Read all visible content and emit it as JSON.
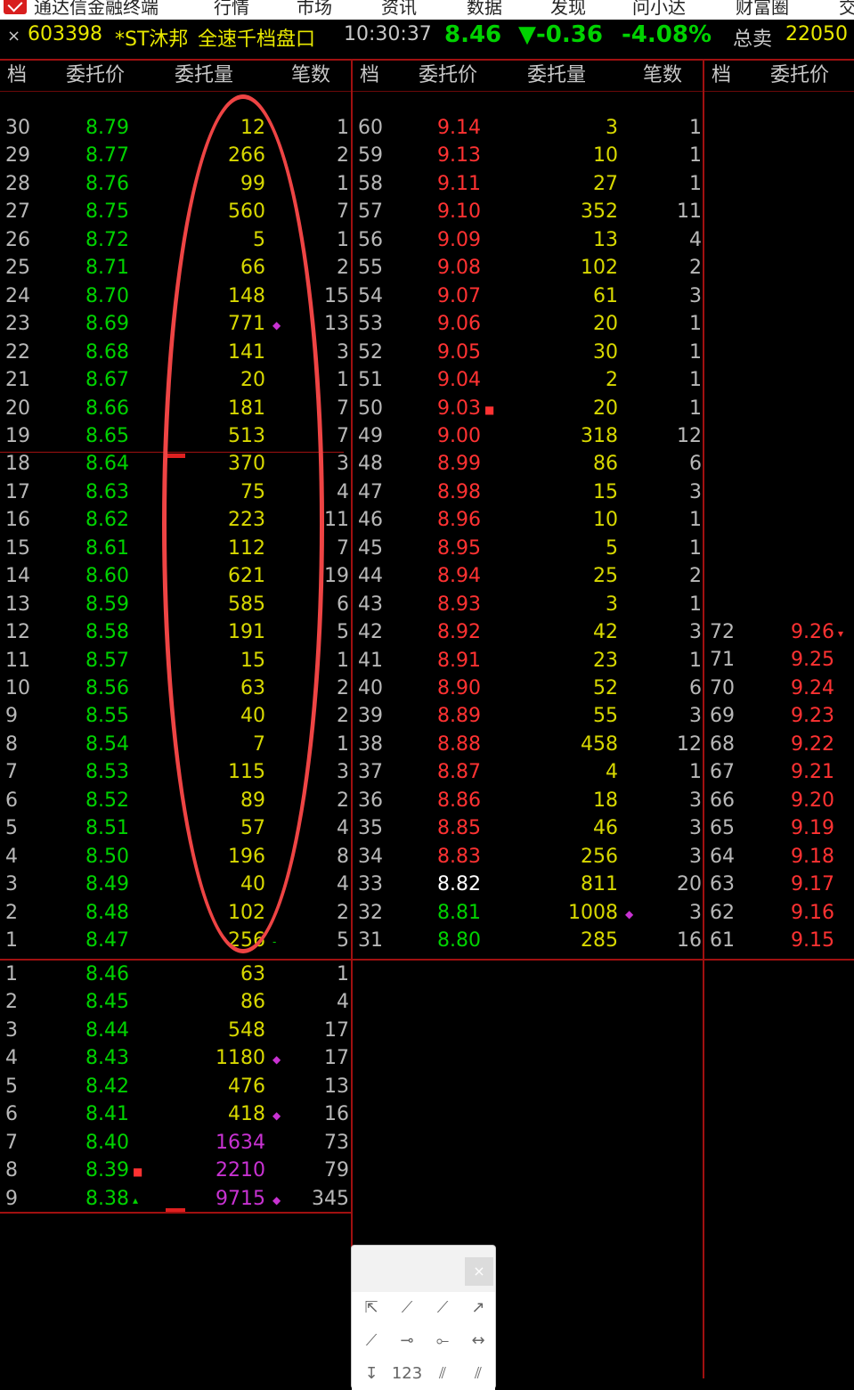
{
  "menu": {
    "app_name": "通达信金融终端",
    "items": [
      "行情",
      "市场",
      "资讯",
      "数据",
      "发现",
      "问小达",
      "财富圈",
      "交"
    ]
  },
  "header": {
    "close_glyph": "×",
    "code": "603398",
    "name": "*ST沐邦",
    "panel": "全速千档盘口",
    "time": "10:30:37",
    "price": "8.46",
    "change": "▼-0.36",
    "change_pct": "-4.08%",
    "total_sell_label": "总卖",
    "total_sell_value": "22050"
  },
  "columns": {
    "level": "档",
    "price": "委托价",
    "volume": "委托量",
    "count": "笔数"
  },
  "colors": {
    "up": "#ff3232",
    "down": "#00d200",
    "flat": "#ffffff",
    "volume": "#d8d800",
    "big_volume": "#c832d2",
    "border": "#a01010"
  },
  "left_sell": [
    {
      "level": "30",
      "price": "8.79",
      "volume": "12",
      "count": "1"
    },
    {
      "level": "29",
      "price": "8.77",
      "volume": "266",
      "count": "2"
    },
    {
      "level": "28",
      "price": "8.76",
      "volume": "99",
      "count": "1"
    },
    {
      "level": "27",
      "price": "8.75",
      "volume": "560",
      "count": "7"
    },
    {
      "level": "26",
      "price": "8.72",
      "volume": "5",
      "count": "1"
    },
    {
      "level": "25",
      "price": "8.71",
      "volume": "66",
      "count": "2"
    },
    {
      "level": "24",
      "price": "8.70",
      "volume": "148",
      "count": "15"
    },
    {
      "level": "23",
      "price": "8.69",
      "volume": "771",
      "count": "13",
      "marker": "◆"
    },
    {
      "level": "22",
      "price": "8.68",
      "volume": "141",
      "count": "3"
    },
    {
      "level": "21",
      "price": "8.67",
      "volume": "20",
      "count": "1"
    },
    {
      "level": "20",
      "price": "8.66",
      "volume": "181",
      "count": "7"
    },
    {
      "level": "19",
      "price": "8.65",
      "volume": "513",
      "count": "7"
    },
    {
      "level": "18",
      "price": "8.64",
      "volume": "370",
      "count": "3"
    },
    {
      "level": "17",
      "price": "8.63",
      "volume": "75",
      "count": "4"
    },
    {
      "level": "16",
      "price": "8.62",
      "volume": "223",
      "count": "11"
    },
    {
      "level": "15",
      "price": "8.61",
      "volume": "112",
      "count": "7"
    },
    {
      "level": "14",
      "price": "8.60",
      "volume": "621",
      "count": "19"
    },
    {
      "level": "13",
      "price": "8.59",
      "volume": "585",
      "count": "6"
    },
    {
      "level": "12",
      "price": "8.58",
      "volume": "191",
      "count": "5"
    },
    {
      "level": "11",
      "price": "8.57",
      "volume": "15",
      "count": "1"
    },
    {
      "level": "10",
      "price": "8.56",
      "volume": "63",
      "count": "2"
    },
    {
      "level": "9",
      "price": "8.55",
      "volume": "40",
      "count": "2"
    },
    {
      "level": "8",
      "price": "8.54",
      "volume": "7",
      "count": "1"
    },
    {
      "level": "7",
      "price": "8.53",
      "volume": "115",
      "count": "3"
    },
    {
      "level": "6",
      "price": "8.52",
      "volume": "89",
      "count": "2"
    },
    {
      "level": "5",
      "price": "8.51",
      "volume": "57",
      "count": "4"
    },
    {
      "level": "4",
      "price": "8.50",
      "volume": "196",
      "count": "8"
    },
    {
      "level": "3",
      "price": "8.49",
      "volume": "40",
      "count": "4"
    },
    {
      "level": "2",
      "price": "8.48",
      "volume": "102",
      "count": "2"
    },
    {
      "level": "1",
      "price": "8.47",
      "volume": "256",
      "count": "5",
      "marker": "-"
    }
  ],
  "left_buy": [
    {
      "level": "1",
      "price": "8.46",
      "volume": "63",
      "count": "1"
    },
    {
      "level": "2",
      "price": "8.45",
      "volume": "86",
      "count": "4"
    },
    {
      "level": "3",
      "price": "8.44",
      "volume": "548",
      "count": "17"
    },
    {
      "level": "4",
      "price": "8.43",
      "volume": "1180",
      "count": "17",
      "marker": "◆"
    },
    {
      "level": "5",
      "price": "8.42",
      "volume": "476",
      "count": "13"
    },
    {
      "level": "6",
      "price": "8.41",
      "volume": "418",
      "count": "16",
      "marker": "◆"
    },
    {
      "level": "7",
      "price": "8.40",
      "volume": "1634",
      "count": "73",
      "big": true
    },
    {
      "level": "8",
      "price": "8.39",
      "volume": "2210",
      "count": "79",
      "big": true,
      "pmarker": "■"
    },
    {
      "level": "9",
      "price": "8.38",
      "volume": "9715",
      "count": "345",
      "big": true,
      "marker": "◆",
      "pmarker": "▴"
    }
  ],
  "mid": [
    {
      "level": "60",
      "price": "9.14",
      "volume": "3",
      "count": "1",
      "c": "red"
    },
    {
      "level": "59",
      "price": "9.13",
      "volume": "10",
      "count": "1",
      "c": "red"
    },
    {
      "level": "58",
      "price": "9.11",
      "volume": "27",
      "count": "1",
      "c": "red"
    },
    {
      "level": "57",
      "price": "9.10",
      "volume": "352",
      "count": "11",
      "c": "red"
    },
    {
      "level": "56",
      "price": "9.09",
      "volume": "13",
      "count": "4",
      "c": "red"
    },
    {
      "level": "55",
      "price": "9.08",
      "volume": "102",
      "count": "2",
      "c": "red"
    },
    {
      "level": "54",
      "price": "9.07",
      "volume": "61",
      "count": "3",
      "c": "red"
    },
    {
      "level": "53",
      "price": "9.06",
      "volume": "20",
      "count": "1",
      "c": "red"
    },
    {
      "level": "52",
      "price": "9.05",
      "volume": "30",
      "count": "1",
      "c": "red"
    },
    {
      "level": "51",
      "price": "9.04",
      "volume": "2",
      "count": "1",
      "c": "red"
    },
    {
      "level": "50",
      "price": "9.03",
      "volume": "20",
      "count": "1",
      "c": "red",
      "pmarker": "■"
    },
    {
      "level": "49",
      "price": "9.00",
      "volume": "318",
      "count": "12",
      "c": "red"
    },
    {
      "level": "48",
      "price": "8.99",
      "volume": "86",
      "count": "6",
      "c": "red"
    },
    {
      "level": "47",
      "price": "8.98",
      "volume": "15",
      "count": "3",
      "c": "red"
    },
    {
      "level": "46",
      "price": "8.96",
      "volume": "10",
      "count": "1",
      "c": "red"
    },
    {
      "level": "45",
      "price": "8.95",
      "volume": "5",
      "count": "1",
      "c": "red"
    },
    {
      "level": "44",
      "price": "8.94",
      "volume": "25",
      "count": "2",
      "c": "red"
    },
    {
      "level": "43",
      "price": "8.93",
      "volume": "3",
      "count": "1",
      "c": "red"
    },
    {
      "level": "42",
      "price": "8.92",
      "volume": "42",
      "count": "3",
      "c": "red"
    },
    {
      "level": "41",
      "price": "8.91",
      "volume": "23",
      "count": "1",
      "c": "red"
    },
    {
      "level": "40",
      "price": "8.90",
      "volume": "52",
      "count": "6",
      "c": "red"
    },
    {
      "level": "39",
      "price": "8.89",
      "volume": "55",
      "count": "3",
      "c": "red"
    },
    {
      "level": "38",
      "price": "8.88",
      "volume": "458",
      "count": "12",
      "c": "red"
    },
    {
      "level": "37",
      "price": "8.87",
      "volume": "4",
      "count": "1",
      "c": "red"
    },
    {
      "level": "36",
      "price": "8.86",
      "volume": "18",
      "count": "3",
      "c": "red"
    },
    {
      "level": "35",
      "price": "8.85",
      "volume": "46",
      "count": "3",
      "c": "red"
    },
    {
      "level": "34",
      "price": "8.83",
      "volume": "256",
      "count": "3",
      "c": "red"
    },
    {
      "level": "33",
      "price": "8.82",
      "volume": "811",
      "count": "20",
      "c": "white"
    },
    {
      "level": "32",
      "price": "8.81",
      "volume": "1008",
      "count": "3",
      "c": "green",
      "marker": "◆"
    },
    {
      "level": "31",
      "price": "8.80",
      "volume": "285",
      "count": "16",
      "c": "green"
    }
  ],
  "right": [
    {
      "level": "72",
      "price": "9.26",
      "pmarker": "▾"
    },
    {
      "level": "71",
      "price": "9.25"
    },
    {
      "level": "70",
      "price": "9.24"
    },
    {
      "level": "69",
      "price": "9.23"
    },
    {
      "level": "68",
      "price": "9.22"
    },
    {
      "level": "67",
      "price": "9.21"
    },
    {
      "level": "66",
      "price": "9.20"
    },
    {
      "level": "65",
      "price": "9.19"
    },
    {
      "level": "64",
      "price": "9.18"
    },
    {
      "level": "63",
      "price": "9.17"
    },
    {
      "level": "62",
      "price": "9.16"
    },
    {
      "level": "61",
      "price": "9.15"
    }
  ],
  "toolbox": {
    "close_glyph": "×",
    "tools": [
      "pointer-icon",
      "segment-icon",
      "line-icon",
      "ray-icon",
      "long-line-icon",
      "horizontal-segment-icon",
      "horizontal-ray-icon",
      "horizontal-line-icon",
      "vertical-line-icon",
      "text-icon",
      "parallel-lines-icon",
      "channel-icon"
    ],
    "tool_glyphs": [
      "⇱",
      "⟋",
      "⟋",
      "↗",
      "⟋",
      "⊸",
      "⟜",
      "↔",
      "↧",
      "123",
      "⫽",
      "⫽"
    ]
  }
}
